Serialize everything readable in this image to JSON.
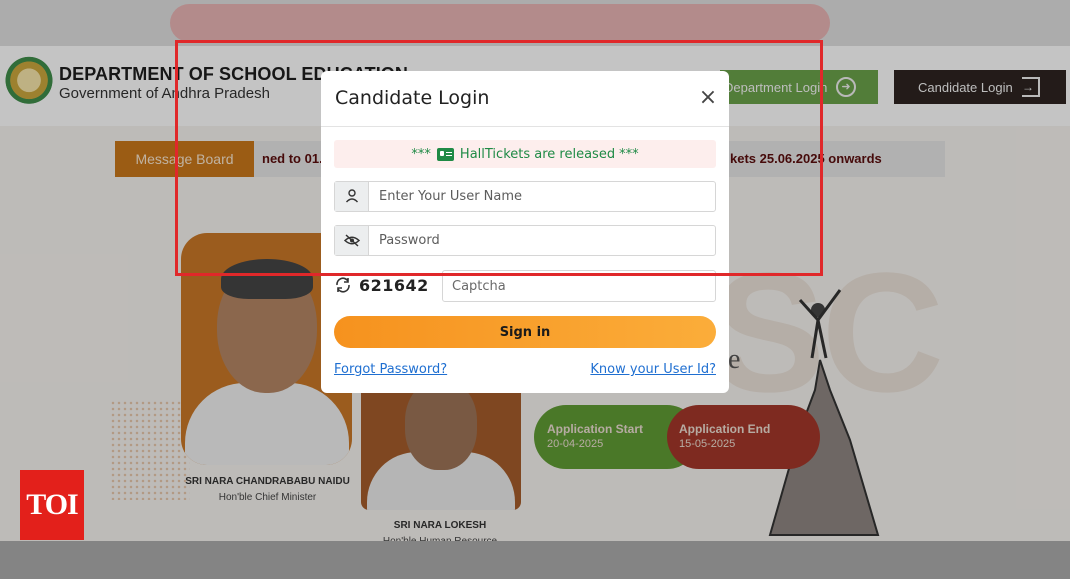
{
  "header": {
    "dept_title": "DEPARTMENT OF SCHOOL EDUCATION",
    "dept_subtitle": "Government of Andhra Pradesh",
    "department_login_label": "Department Login",
    "candidate_login_label": "Candidate Login"
  },
  "message_board": {
    "label": "Message Board",
    "ticker_left": "ned to 01.",
    "ticker_right": "kets 25.06.2025 onwards"
  },
  "leaders": [
    {
      "name": "SRI NARA CHANDRABABU NAIDU",
      "role": "Hon'ble Chief Minister"
    },
    {
      "name": "SRI NARA LOKESH",
      "role": "Hon'ble Human Resource"
    }
  ],
  "application": {
    "start_label": "Application Start",
    "start_date": "20-04-2025",
    "end_label": "Application End",
    "end_date": "15-05-2025"
  },
  "background_text": {
    "big_letters": "SC",
    "partial_e": "e"
  },
  "badge": {
    "text": "TOI"
  },
  "modal": {
    "title": "Candidate Login",
    "close_glyph": "×",
    "notice_prefix": "***",
    "notice_text": "HallTickets are released",
    "notice_suffix": "***",
    "username_placeholder": "Enter Your User Name",
    "password_placeholder": "Password",
    "captcha_code": "621642",
    "captcha_placeholder": "Captcha",
    "signin_label": "Sign in",
    "forgot_label": "Forgot Password?",
    "knowid_label": "Know your User Id?"
  },
  "colors": {
    "signin_gradient_start": "#f6921e",
    "signin_gradient_end": "#fbad3a",
    "notice_text": "#1f8a45",
    "link": "#1f6fd1",
    "highlight_box": "#e0282a",
    "toi_red": "#e3201b"
  }
}
